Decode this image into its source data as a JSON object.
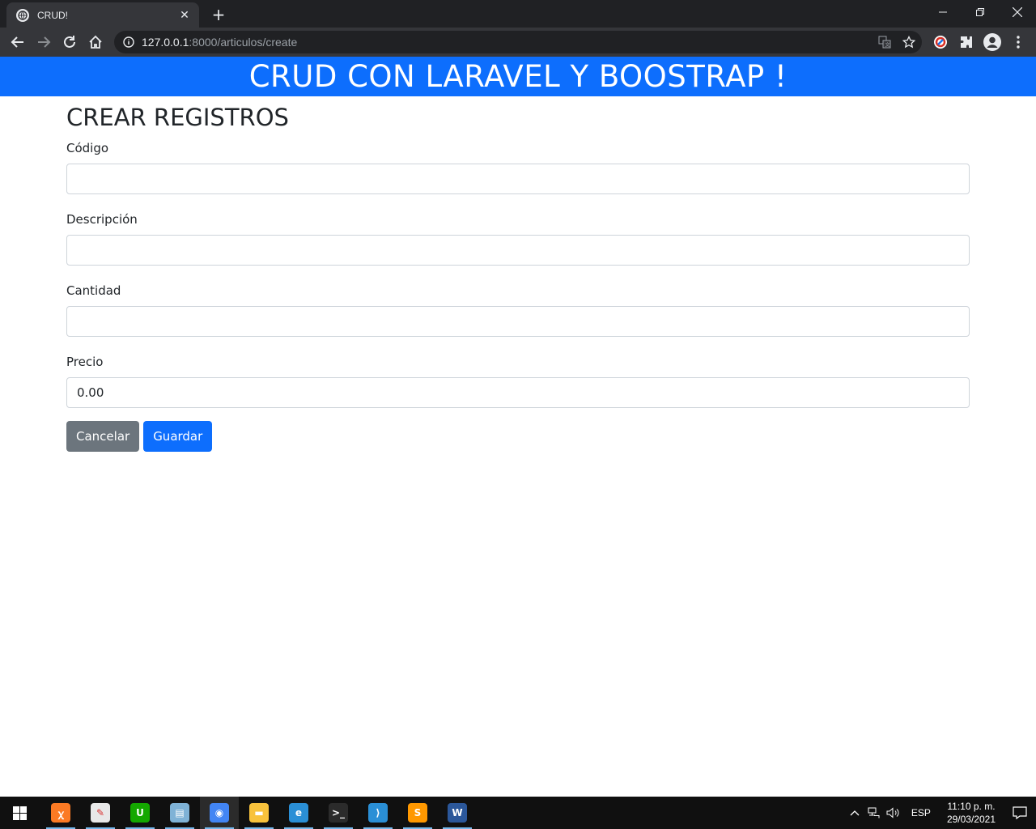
{
  "browser": {
    "tab_title": "CRUD!",
    "tab_close": "✕",
    "new_tab": "+",
    "url_host": "127.0.0.1",
    "url_path": ":8000/articulos/create"
  },
  "page": {
    "banner": "CRUD CON LARAVEL Y BOOSTRAP !",
    "title": "CREAR REGISTROS",
    "fields": [
      {
        "label": "Código",
        "value": ""
      },
      {
        "label": "Descripción",
        "value": ""
      },
      {
        "label": "Cantidad",
        "value": ""
      },
      {
        "label": "Precio",
        "value": "0.00"
      }
    ],
    "buttons": {
      "cancel": "Cancelar",
      "save": "Guardar"
    },
    "colors": {
      "banner": "#0d6efd",
      "primary": "#0d6efd",
      "secondary": "#6c757d"
    }
  },
  "taskbar": {
    "apps": [
      {
        "icon": "xampp-icon",
        "color": "#fb7a24",
        "glyph": "ꭓ"
      },
      {
        "icon": "paint-icon",
        "color": "#e8e8e8",
        "glyph": "✎"
      },
      {
        "icon": "upwork-icon",
        "color": "#14a800",
        "glyph": "U"
      },
      {
        "icon": "notepad-icon",
        "color": "#7fb2d6",
        "glyph": "▤"
      },
      {
        "icon": "chrome-icon",
        "color": "#4285f4",
        "glyph": "◉"
      },
      {
        "icon": "file-explorer-icon",
        "color": "#f8c23c",
        "glyph": "▬"
      },
      {
        "icon": "edge-icon",
        "color": "#2a8fd6",
        "glyph": "e"
      },
      {
        "icon": "terminal-icon",
        "color": "#2b2b2b",
        "glyph": ">_"
      },
      {
        "icon": "vscode-icon",
        "color": "#2a8fd6",
        "glyph": "⟩"
      },
      {
        "icon": "sublime-text-icon",
        "color": "#ff9800",
        "glyph": "S"
      },
      {
        "icon": "word-icon",
        "color": "#2b579a",
        "glyph": "W"
      }
    ],
    "language": "ESP",
    "time": "11:10 p. m.",
    "date": "29/03/2021"
  }
}
